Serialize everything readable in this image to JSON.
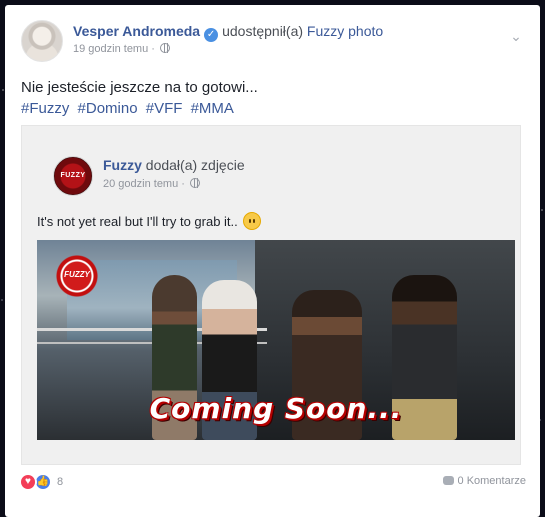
{
  "post": {
    "author": "Vesper Andromeda",
    "action": "udostępnił(a)",
    "target": "Fuzzy photo",
    "time": "19 godzin temu",
    "separator": "·",
    "text": "Nie jesteście jeszcze na to gotowi...",
    "hashtags": [
      "#Fuzzy",
      "#Domino",
      "#VFF",
      "#MMA"
    ]
  },
  "shared": {
    "avatar_text": "FUZZY",
    "author": "Fuzzy",
    "action": "dodał(a) zdjęcie",
    "time": "20 godzin temu",
    "separator": "·",
    "text": "It's not yet real but I'll try to grab it..",
    "photo": {
      "logo_text": "FUZZY",
      "overlay_text": "Coming Soon..."
    }
  },
  "footer": {
    "reactions_count": "8",
    "comments": "0 Komentarze"
  },
  "colors": {
    "link": "#3b5998",
    "meta": "#90949c",
    "love": "#f33e58",
    "like": "#4a7fe8"
  }
}
